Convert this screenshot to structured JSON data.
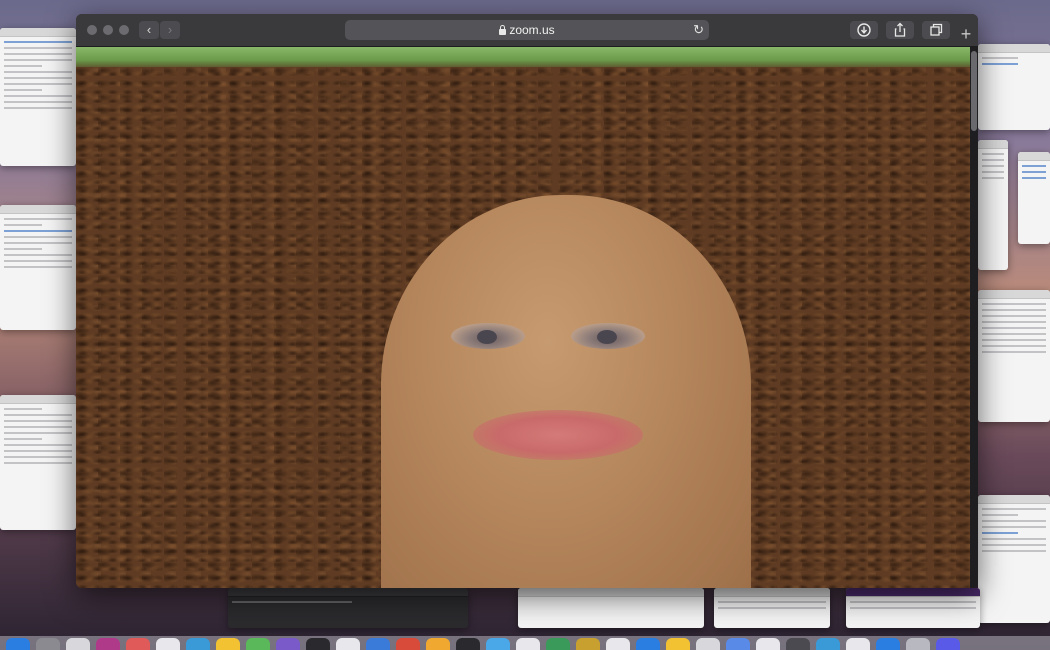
{
  "browser": {
    "url": "zoom.us",
    "icons": {
      "back": "chevron-left-icon",
      "forward": "chevron-right-icon",
      "lock": "lock-icon",
      "reload": "reload-icon",
      "downloads": "download-icon",
      "share": "share-icon",
      "tabs": "tabs-overview-icon",
      "new_tab": "plus-icon"
    },
    "glyphs": {
      "back": "‹",
      "forward": "›",
      "reload": "↻",
      "downloads": "⬇",
      "share": "⇧",
      "tabs": "❐",
      "new_tab": "+"
    }
  },
  "video": {
    "description": "video-feed-face-filter"
  },
  "colors": {
    "toolbar": "#3a3a3c",
    "url_field": "#545458",
    "soil": "#5e3b22",
    "grass": "#6b9a4a",
    "skin": "#b5865c",
    "lips": "#c96a6a"
  }
}
